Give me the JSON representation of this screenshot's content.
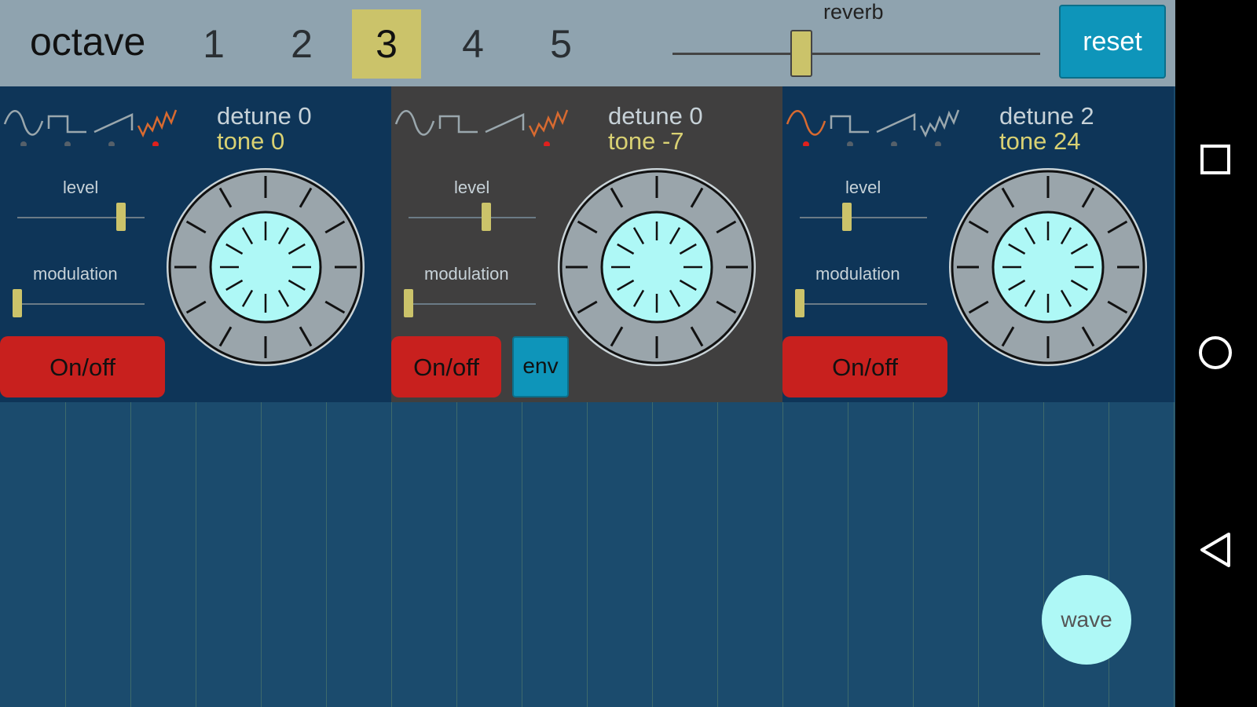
{
  "topbar": {
    "octave_label": "octave",
    "octaves": [
      "1",
      "2",
      "3",
      "4",
      "5"
    ],
    "selected_octave": "3",
    "reverb_label": "reverb",
    "reverb_level": 0.34,
    "reset_label": "reset"
  },
  "oscillators": [
    {
      "detune": "detune 0",
      "tone": "tone 0",
      "selected_wave": 3,
      "level_label": "level",
      "level": 0.88,
      "modulation_label": "modulation",
      "modulation": 0.0,
      "onoff_label": "On/off"
    },
    {
      "detune": "detune 0",
      "tone": "tone -7",
      "selected_wave": 3,
      "level_label": "level",
      "level": 0.66,
      "modulation_label": "modulation",
      "modulation": 0.0,
      "onoff_label": "On/off",
      "env_label": "env"
    },
    {
      "detune": "detune 2",
      "tone": "tone 24",
      "selected_wave": 0,
      "level_label": "level",
      "level": 0.4,
      "modulation_label": "modulation",
      "modulation": 0.0,
      "onoff_label": "On/off"
    }
  ],
  "keyboard": {
    "wave_label": "wave"
  },
  "colors": {
    "accent": "#cbc36a",
    "reset": "#0e95ba",
    "onoff": "#c8201e",
    "knob_inner": "#aef8f6",
    "panel": "#0e3558",
    "panel_alt": "#403f3f"
  },
  "navbar": {
    "icons": [
      "recents-icon",
      "home-icon",
      "back-icon"
    ]
  }
}
